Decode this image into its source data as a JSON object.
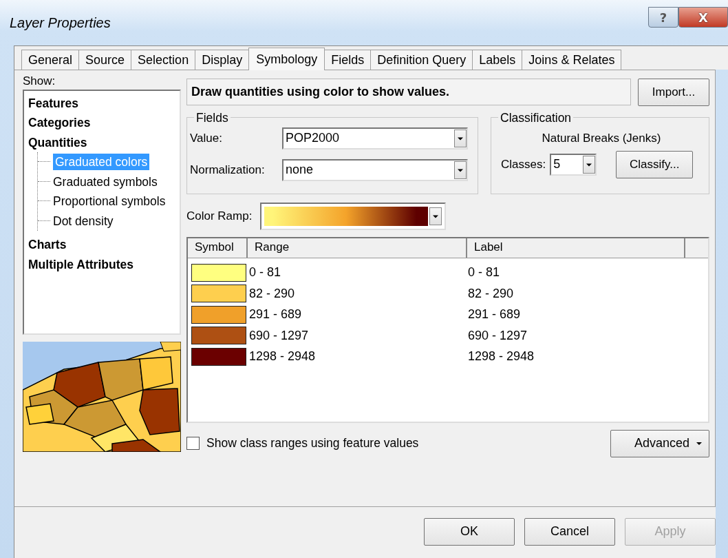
{
  "window": {
    "title": "Layer Properties",
    "controls": [
      {
        "kind": "help",
        "label": "?"
      },
      {
        "kind": "close",
        "label": "X"
      }
    ]
  },
  "tabs": [
    {
      "label": "General",
      "selected": false
    },
    {
      "label": "Source",
      "selected": false
    },
    {
      "label": "Selection",
      "selected": false
    },
    {
      "label": "Display",
      "selected": false
    },
    {
      "label": "Symbology",
      "selected": true
    },
    {
      "label": "Fields",
      "selected": false
    },
    {
      "label": "Definition Query",
      "selected": false
    },
    {
      "label": "Labels",
      "selected": false
    },
    {
      "label": "Joins & Relates",
      "selected": false
    }
  ],
  "show": {
    "label": "Show:",
    "tree": [
      {
        "label": "Features",
        "selected": false
      },
      {
        "label": "Categories",
        "selected": false
      },
      {
        "label": "Quantities",
        "selected": false,
        "children": [
          {
            "label": "Graduated colors",
            "selected": true
          },
          {
            "label": "Graduated symbols",
            "selected": false
          },
          {
            "label": "Proportional symbols",
            "selected": false
          },
          {
            "label": "Dot density",
            "selected": false
          }
        ]
      },
      {
        "label": "Charts",
        "selected": false
      },
      {
        "label": "Multiple Attributes",
        "selected": false
      }
    ]
  },
  "description": "Draw quantities using color to show values.",
  "import_button": "Import...",
  "fields": {
    "title": "Fields",
    "value_label": "Value:",
    "value": "POP2000",
    "normalization_label": "Normalization:",
    "normalization": "none"
  },
  "classification": {
    "title": "Classification",
    "method": "Natural Breaks (Jenks)",
    "classes_label": "Classes:",
    "classes": "5",
    "classify_button": "Classify..."
  },
  "color_ramp": {
    "label": "Color Ramp:",
    "stops": [
      {
        "color": "#fff57a"
      },
      {
        "color": "#f4a32a"
      },
      {
        "color": "#5e0000"
      }
    ]
  },
  "table": {
    "columns": [
      "Symbol",
      "Range",
      "Label"
    ],
    "rows": [
      {
        "color": "#ffff80",
        "range": "0 - 81",
        "label": "0 - 81"
      },
      {
        "color": "#fecf4e",
        "range": "82 - 290",
        "label": "82 - 290"
      },
      {
        "color": "#f0a02a",
        "range": "291 - 689",
        "label": "291 - 689"
      },
      {
        "color": "#ae5013",
        "range": "690 - 1297",
        "label": "690 - 1297"
      },
      {
        "color": "#6b0000",
        "range": "1298 - 2948",
        "label": "1298 - 2948"
      }
    ]
  },
  "show_class_ranges": {
    "label": "Show class ranges using feature values",
    "checked": false
  },
  "advanced_button": "Advanced",
  "buttons": [
    {
      "label": "OK",
      "disabled": false
    },
    {
      "label": "Cancel",
      "disabled": false
    },
    {
      "label": "Apply",
      "disabled": true
    }
  ]
}
